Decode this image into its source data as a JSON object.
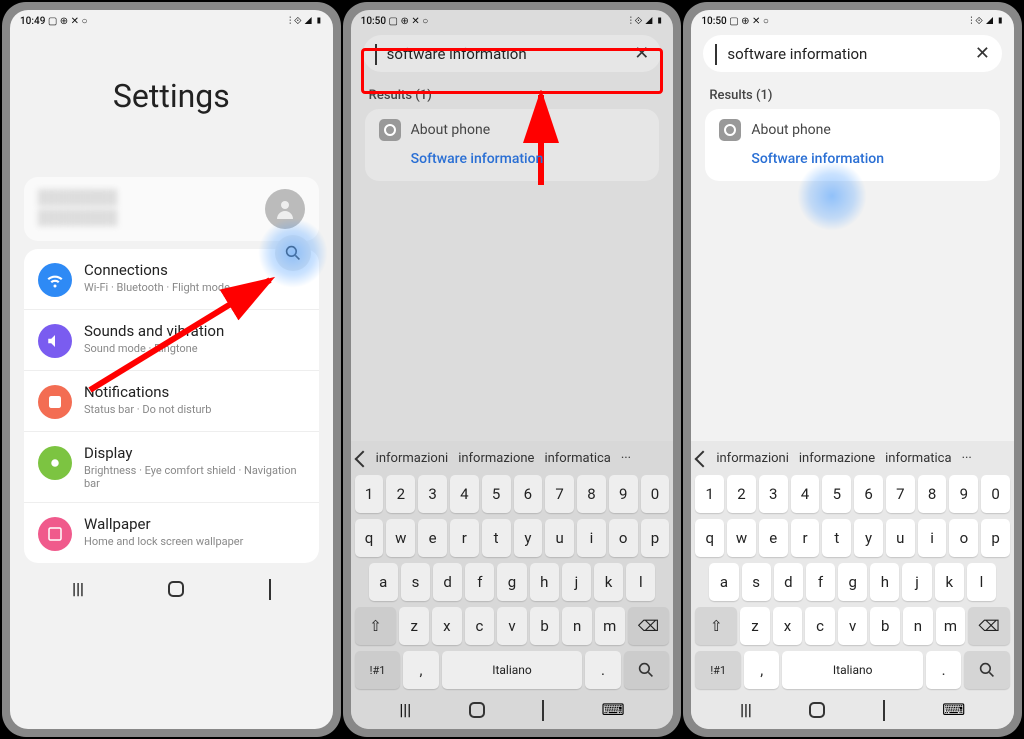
{
  "status": {
    "time1": "10:49",
    "time23": "10:50",
    "icons": "▢ ⊕ ✕ ○",
    "right": "⫶ ⟐ ◢ ▮"
  },
  "screen1": {
    "title": "Settings",
    "items": [
      {
        "title": "Connections",
        "sub": "Wi-Fi · Bluetooth · Flight mode",
        "color": "#2e8af5",
        "icon": "wifi-icon"
      },
      {
        "title": "Sounds and vibration",
        "sub": "Sound mode · Ringtone",
        "color": "#7a5cf0",
        "icon": "sound-icon"
      },
      {
        "title": "Notifications",
        "sub": "Status bar · Do not disturb",
        "color": "#f36d53",
        "icon": "notifications-icon"
      },
      {
        "title": "Display",
        "sub": "Brightness · Eye comfort shield · Navigation bar",
        "color": "#7cc441",
        "icon": "display-icon"
      },
      {
        "title": "Wallpaper",
        "sub": "Home and lock screen wallpaper",
        "color": "#f05a8c",
        "icon": "wallpaper-icon"
      }
    ]
  },
  "search": {
    "query": "software information",
    "results_label": "Results (1)",
    "result_parent": "About phone",
    "result_link": "Software information"
  },
  "keyboard": {
    "suggestions": [
      "informazioni",
      "informazione",
      "informatica"
    ],
    "row_num": [
      "1",
      "2",
      "3",
      "4",
      "5",
      "6",
      "7",
      "8",
      "9",
      "0"
    ],
    "row1": [
      "q",
      "w",
      "e",
      "r",
      "t",
      "y",
      "u",
      "i",
      "o",
      "p"
    ],
    "row2": [
      "a",
      "s",
      "d",
      "f",
      "g",
      "h",
      "j",
      "k",
      "l"
    ],
    "row3": [
      "z",
      "x",
      "c",
      "v",
      "b",
      "n",
      "m"
    ],
    "shift": "⇧",
    "back": "⌫",
    "sym": "!#1",
    "comma": ",",
    "space": "Italiano",
    "period": "."
  }
}
